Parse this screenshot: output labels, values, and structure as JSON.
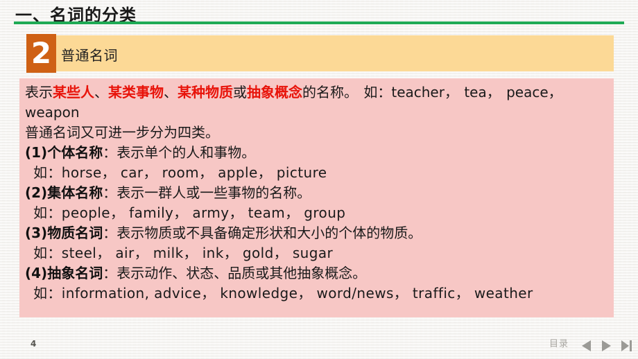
{
  "slide": {
    "title": "一、名词的分类",
    "page_number": "4",
    "accent_green": "#1faa55",
    "badge_orange": "#cf6115",
    "banner_tan": "#fcd996",
    "body_pink": "#f7c7c5",
    "keyword_red": "#e8130a"
  },
  "section": {
    "number": "2",
    "title": "普通名词"
  },
  "body": {
    "intro": {
      "prefix": "表示",
      "kw1": "某些人",
      "sep1": "、",
      "kw2": "某类事物",
      "sep2": "、",
      "kw3": "某种物质",
      "mid": "或",
      "kw4": "抽象概念",
      "suffix": "的名称。 如：teacher， tea， peace，",
      "wrap": "weapon"
    },
    "lead": "普通名词又可进一步分为四类。",
    "categories": [
      {
        "label": "(1)个体名称",
        "definition": "：表示单个的人和事物。",
        "examples": "如：horse， car， room， apple， picture"
      },
      {
        "label": "(2)集体名称",
        "definition": "：表示一群人或一些事物的名称。",
        "examples": "如：people， family， army， team， group"
      },
      {
        "label": "(3)物质名词",
        "definition": "：表示物质或不具备确定形状和大小的个体的物质。",
        "examples": "如：steel， air， milk， ink， gold， sugar"
      },
      {
        "label": "(4)抽象名词",
        "definition": "：表示动作、状态、品质或其他抽象概念。",
        "examples": "如：information, advice， knowledge， word/news， traffic， weather"
      }
    ]
  },
  "footer": {
    "toc_label": "目录",
    "nav": {
      "previous": "previous-slide",
      "next": "next-slide",
      "last": "last-slide"
    }
  }
}
